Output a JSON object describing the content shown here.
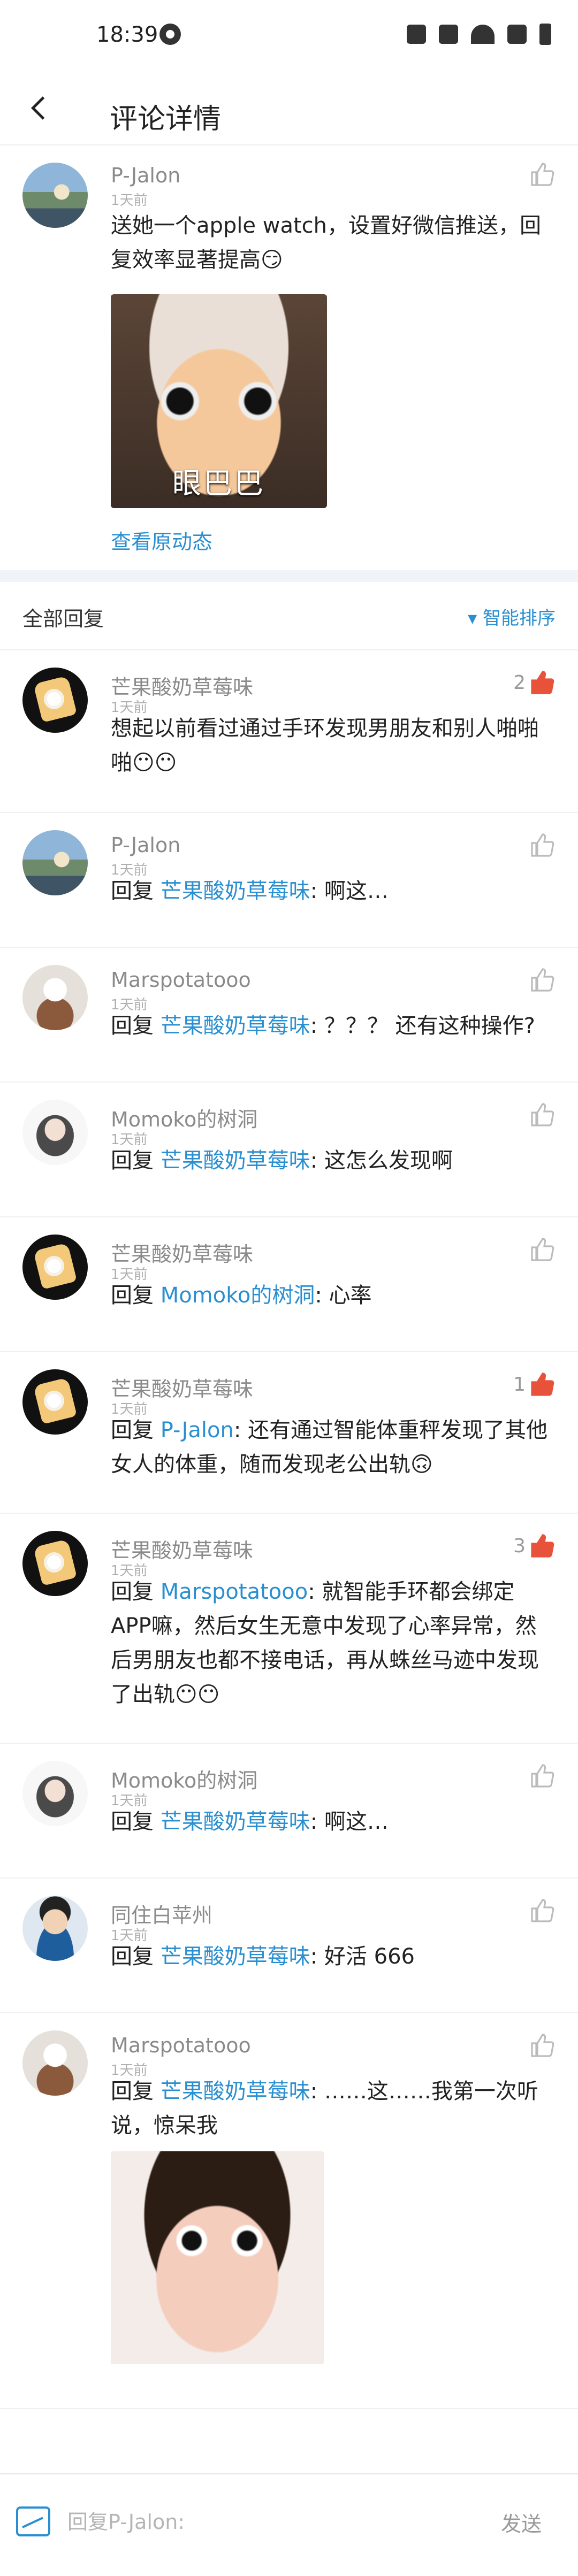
{
  "status_bar": {
    "time": "18:39"
  },
  "header": {
    "title": "评论详情"
  },
  "post": {
    "author": "P-Jalon",
    "time": "1天前",
    "content": "送她一个apple watch，设置好微信推送，回复效率显著提高😏",
    "image_caption": "眼巴巴",
    "view_link": "查看原动态"
  },
  "replies_header": {
    "title": "全部回复",
    "sort": "智能排序"
  },
  "replies": [
    {
      "author": "芒果酸奶草莓味",
      "time": "1天前",
      "prefix": "",
      "mention": "",
      "text": "想起以前看过通过手环发现男朋友和别人啪啪啪😶😶",
      "likes": "2"
    },
    {
      "author": "P-Jalon",
      "time": "1天前",
      "prefix": "回复 ",
      "mention": "芒果酸奶草莓味",
      "text": ": 啊这…",
      "likes": ""
    },
    {
      "author": "Marspotatooo",
      "time": "1天前",
      "prefix": "回复 ",
      "mention": "芒果酸奶草莓味",
      "text": ": ？？？ 还有这种操作?",
      "likes": ""
    },
    {
      "author": "Momoko的树洞",
      "time": "1天前",
      "prefix": "回复 ",
      "mention": "芒果酸奶草莓味",
      "text": ": 这怎么发现啊",
      "likes": ""
    },
    {
      "author": "芒果酸奶草莓味",
      "time": "1天前",
      "prefix": "回复 ",
      "mention": "Momoko的树洞",
      "text": ": 心率",
      "likes": ""
    },
    {
      "author": "芒果酸奶草莓味",
      "time": "1天前",
      "prefix": "回复 ",
      "mention": "P-Jalon",
      "text": ": 还有通过智能体重秤发现了其他女人的体重，随而发现老公出轨🙃",
      "likes": "1"
    },
    {
      "author": "芒果酸奶草莓味",
      "time": "1天前",
      "prefix": "回复 ",
      "mention": "Marspotatooo",
      "text": ": 就智能手环都会绑定APP嘛，然后女生无意中发现了心率异常，然后男朋友也都不接电话，再从蛛丝马迹中发现了出轨😶😶",
      "likes": "3"
    },
    {
      "author": "Momoko的树洞",
      "time": "1天前",
      "prefix": "回复 ",
      "mention": "芒果酸奶草莓味",
      "text": ": 啊这…",
      "likes": ""
    },
    {
      "author": "同住白苹州",
      "time": "1天前",
      "prefix": "回复 ",
      "mention": "芒果酸奶草莓味",
      "text": ": 好活 666",
      "likes": ""
    },
    {
      "author": "Marspotatooo",
      "time": "1天前",
      "prefix": "回复 ",
      "mention": "芒果酸奶草莓味",
      "text": ": ……这……我第一次听说，惊呆我",
      "likes": ""
    }
  ],
  "bottom_bar": {
    "placeholder": "回复P-Jalon:",
    "send": "发送"
  }
}
